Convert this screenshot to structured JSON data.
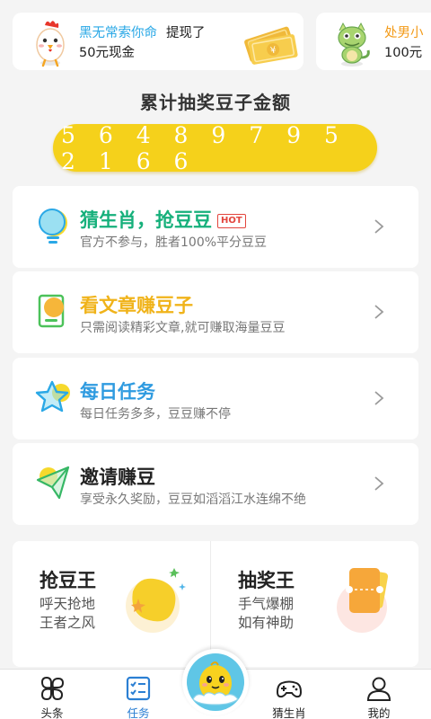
{
  "ticker": [
    {
      "name": "黑无常索你命",
      "action": "提现了",
      "amount": "50元现金"
    },
    {
      "name": "处男小",
      "amount": "100元"
    }
  ],
  "total": {
    "title": "累计抽奖豆子金额",
    "amount": "5 6 4 8 9 7 9 5 2 1 6 6"
  },
  "tasks": [
    {
      "title": "猜生肖，抢豆豆",
      "badge": "HOT",
      "subtitle": "官方不参与，胜者100%平分豆豆",
      "color": "#16b07b"
    },
    {
      "title": "看文章赚豆子",
      "subtitle": "只需阅读精彩文章,就可赚取海量豆豆",
      "color": "#f0b31a"
    },
    {
      "title": "每日任务",
      "subtitle": "每日任务多多，豆豆赚不停",
      "color": "#2f9be0"
    },
    {
      "title": "邀请赚豆",
      "subtitle": "享受永久奖励，豆豆如滔滔江水连绵不绝",
      "color": "#222222"
    }
  ],
  "kings": [
    {
      "title": "抢豆王",
      "sub1": "呼天抢地",
      "sub2": "王者之风"
    },
    {
      "title": "抽奖王",
      "sub1": "手气爆棚",
      "sub2": "如有神助"
    }
  ],
  "tabs": [
    {
      "label": "头条",
      "icon": "clover-icon"
    },
    {
      "label": "任务",
      "icon": "checklist-icon",
      "active": true
    },
    {
      "label": "",
      "icon": "mascot-center-icon"
    },
    {
      "label": "猜生肖",
      "icon": "gamepad-icon"
    },
    {
      "label": "我的",
      "icon": "profile-icon"
    }
  ],
  "colors": {
    "accent": "#f5d11b",
    "activeTab": "#2b7fd3",
    "tickerName": "#2aa8e6"
  }
}
